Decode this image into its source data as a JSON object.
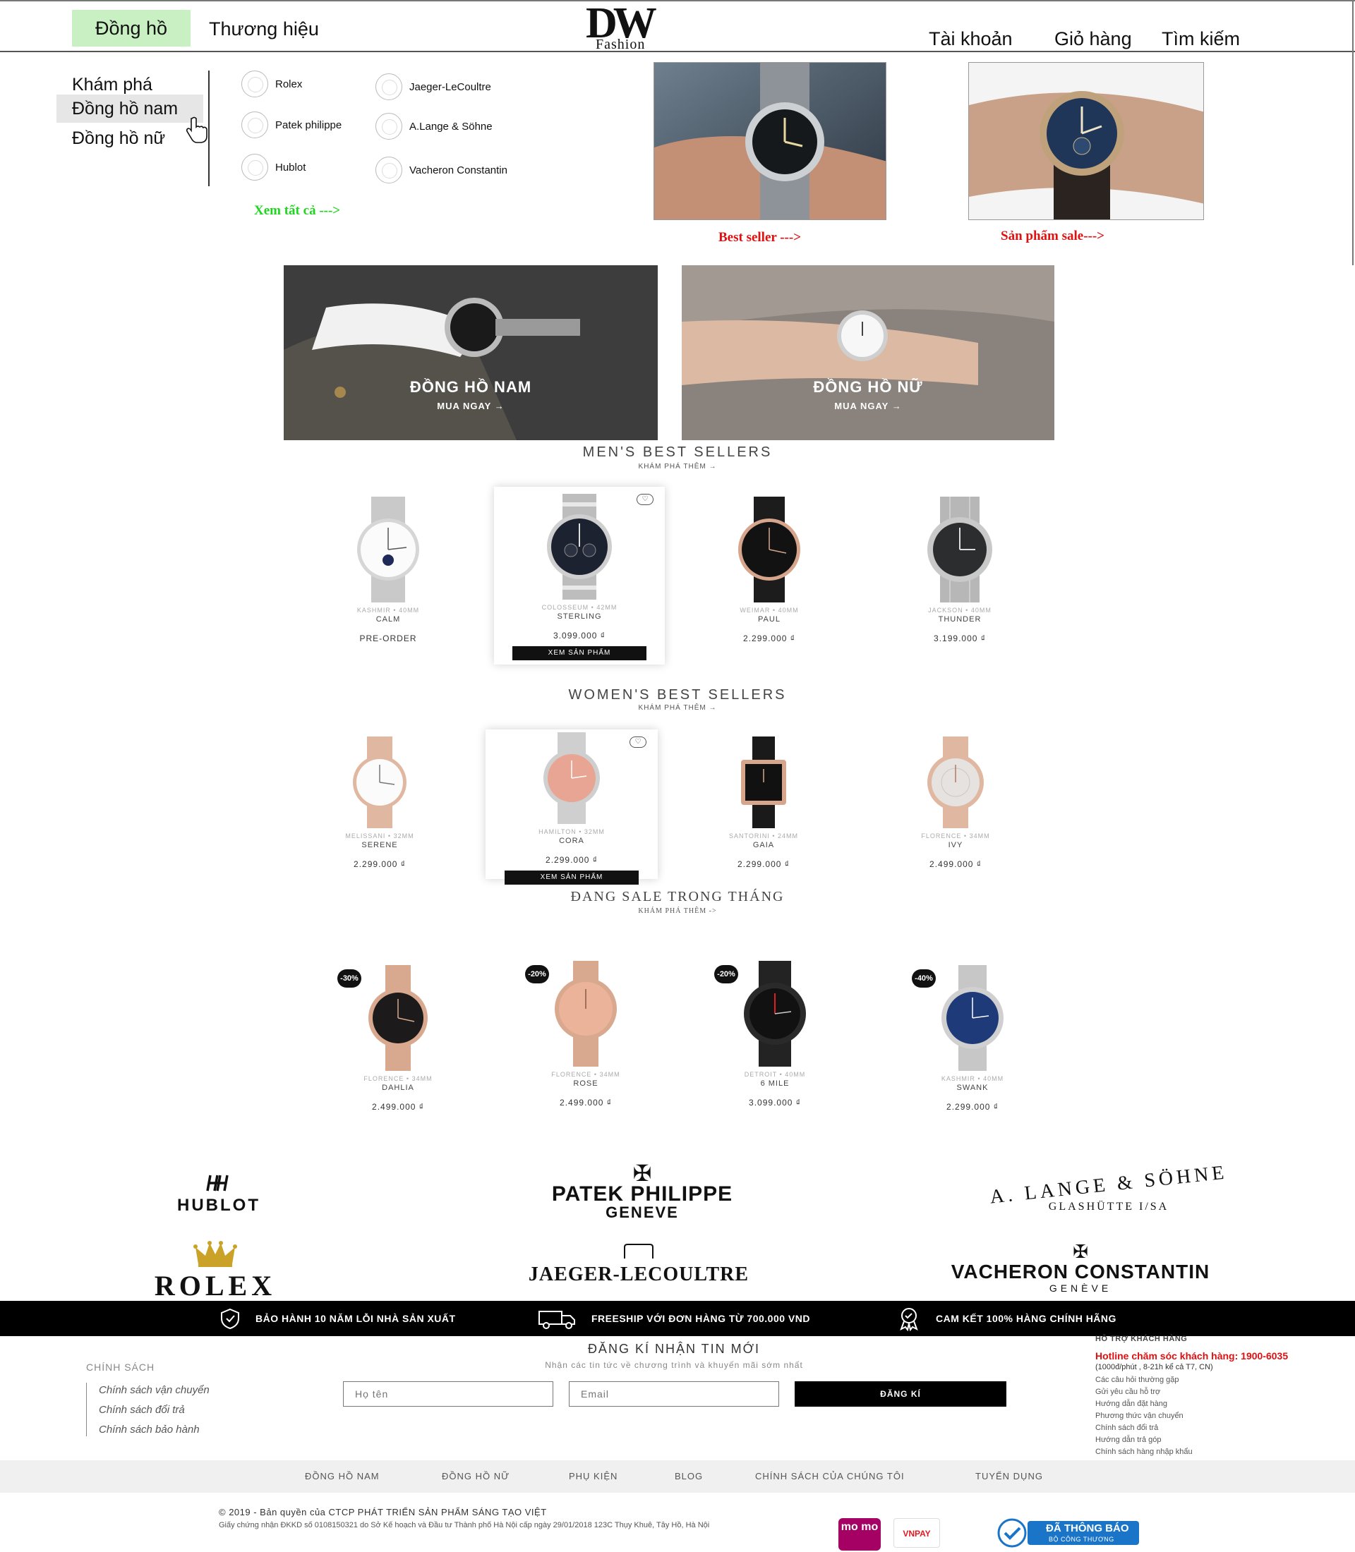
{
  "header": {
    "nav_watches": "Đồng hồ",
    "nav_brands": "Thương hiệu",
    "logo_mark": "DW",
    "logo_sub": "Fashion",
    "account": "Tài khoản",
    "cart": "Giỏ hàng",
    "search": "Tìm kiếm"
  },
  "menu": {
    "categories": [
      "Khám phá",
      "Đồng hồ nam",
      "Đồng hồ nữ"
    ],
    "brands": [
      "Rolex",
      "Patek philippe",
      "Hublot",
      "Jaeger-LeCoultre",
      "A.Lange & Söhne",
      "Vacheron Constantin"
    ],
    "see_all": "Xem tất cả --->",
    "best_seller": "Best seller --->",
    "sale_products": "Sản phẩm sale--->"
  },
  "banners": {
    "men_title": "ĐỒNG HỒ NAM",
    "men_cta": "MUA NGAY →",
    "women_title": "ĐỒNG HỒ NỮ",
    "women_cta": "MUA NGAY →"
  },
  "mens_best": {
    "title": "MEN'S BEST SELLERS",
    "subtitle": "KHÁM PHÁ THÊM →",
    "products": [
      {
        "spec": "KASHMIR • 40MM",
        "name": "CALM",
        "price": "PRE-ORDER"
      },
      {
        "spec": "COLOSSEUM • 42MM",
        "name": "STERLING",
        "price": "3.099.000 ₫",
        "button": "XEM SẢN PHẨM"
      },
      {
        "spec": "WEIMAR • 40MM",
        "name": "PAUL",
        "price": "2.299.000 ₫"
      },
      {
        "spec": "JACKSON • 40MM",
        "name": "THUNDER",
        "price": "3.199.000 ₫"
      }
    ]
  },
  "womens_best": {
    "title": "WOMEN'S BEST SELLERS",
    "subtitle": "KHÁM PHÁ THÊM →",
    "products": [
      {
        "spec": "MELISSANI • 32MM",
        "name": "SERENE",
        "price": "2.299.000 ₫"
      },
      {
        "spec": "HAMILTON • 32MM",
        "name": "CORA",
        "price": "2.299.000 ₫",
        "button": "XEM SẢN PHẨM"
      },
      {
        "spec": "SANTORINI • 24MM",
        "name": "GAIA",
        "price": "2.299.000 ₫"
      },
      {
        "spec": "FLORENCE • 34MM",
        "name": "IVY",
        "price": "2.499.000 ₫"
      }
    ]
  },
  "sale": {
    "title": "ĐANG SALE TRONG THÁNG",
    "subtitle": "KHÁM PHÁ THÊM ->",
    "products": [
      {
        "badge": "-30%",
        "spec": "FLORENCE • 34MM",
        "name": "DAHLIA",
        "price": "2.499.000 ₫"
      },
      {
        "badge": "-20%",
        "spec": "FLORENCE • 34MM",
        "name": "ROSE",
        "price": "2.499.000 ₫"
      },
      {
        "badge": "-20%",
        "spec": "DETROIT • 40MM",
        "name": "6 MILE",
        "price": "3.099.000 ₫"
      },
      {
        "badge": "-40%",
        "spec": "KASHMIR • 40MM",
        "name": "SWANK",
        "price": "2.299.000 ₫"
      }
    ]
  },
  "brand_logos": {
    "hublot": "HUBLOT",
    "patek_1": "PATEK PHILIPPE",
    "patek_2": "GENEVE",
    "lange_1": "A. LANGE & SÖHNE",
    "lange_2": "GLASHÜTTE I/SA",
    "rolex": "ROLEX",
    "jaeger": "JAEGER-LECOULTRE",
    "vacheron_1": "VACHERON CONSTANTIN",
    "vacheron_2": "GENÈVE"
  },
  "features": [
    {
      "icon": "shield-icon",
      "text": "BẢO HÀNH 10 NĂM LỖI NHÀ SẢN XUẤT"
    },
    {
      "icon": "truck-icon",
      "text": "FREESHIP VỚI ĐƠN HÀNG TỪ 700.000 VND"
    },
    {
      "icon": "award-icon",
      "text": "CAM KẾT 100% HÀNG CHÍNH HÃNG"
    }
  ],
  "footer": {
    "policy_title": "CHÍNH SÁCH",
    "policies": [
      "Chính sách vận chuyển",
      "Chính sách đổi trả",
      "Chính sách bảo hành"
    ],
    "newsletter_title": "ĐĂNG KÍ NHẬN TIN MỚI",
    "newsletter_sub": "Nhận các tin tức về chương trình và khuyến mãi sớm nhất",
    "name_placeholder": "Họ tên",
    "email_placeholder": "Email",
    "subscribe": "ĐĂNG KÍ",
    "support_title": "HỖ TRỢ KHÁCH HÀNG",
    "hotline": "Hotline chăm sóc khách hàng: 1900-6035",
    "hours": "(1000đ/phút , 8-21h kể cả T7, CN)",
    "support_links": [
      "Các câu hỏi thường gặp",
      "Gửi yêu cầu hỗ trợ",
      "Hướng dẫn đặt hàng",
      "Phương thức vận chuyển",
      "Chính sách đổi trả",
      "Hướng dẫn trả góp",
      "Chính sách hàng nhập khẩu"
    ],
    "nav": [
      "ĐỒNG HỒ NAM",
      "ĐỒNG HỒ NỮ",
      "PHỤ KIỆN",
      "BLOG",
      "CHÍNH SÁCH CỦA CHÚNG TÔI",
      "TUYỂN DỤNG"
    ],
    "copyright": "© 2019 - Bản quyền của CTCP PHÁT TRIỂN SẢN PHẨM SÁNG TẠO VIỆT",
    "company_info": "Giấy chứng nhận ĐKKD số 0108150321 do Sở Kế hoạch và Đầu tư Thành phố Hà Nội cấp ngày 29/01/2018 123C Thụy Khuê, Tây Hồ, Hà Nội",
    "momo": "mo mo",
    "vnpay": "VNPAY",
    "bct_1": "ĐÃ THÔNG BÁO",
    "bct_2": "BỘ CÔNG THƯƠNG"
  },
  "colors": {
    "accent_green": "#c9f0c3",
    "link_green": "#1ed61e",
    "link_red": "#e01010",
    "rose_gold": "#d9a98f",
    "black": "#000000"
  }
}
